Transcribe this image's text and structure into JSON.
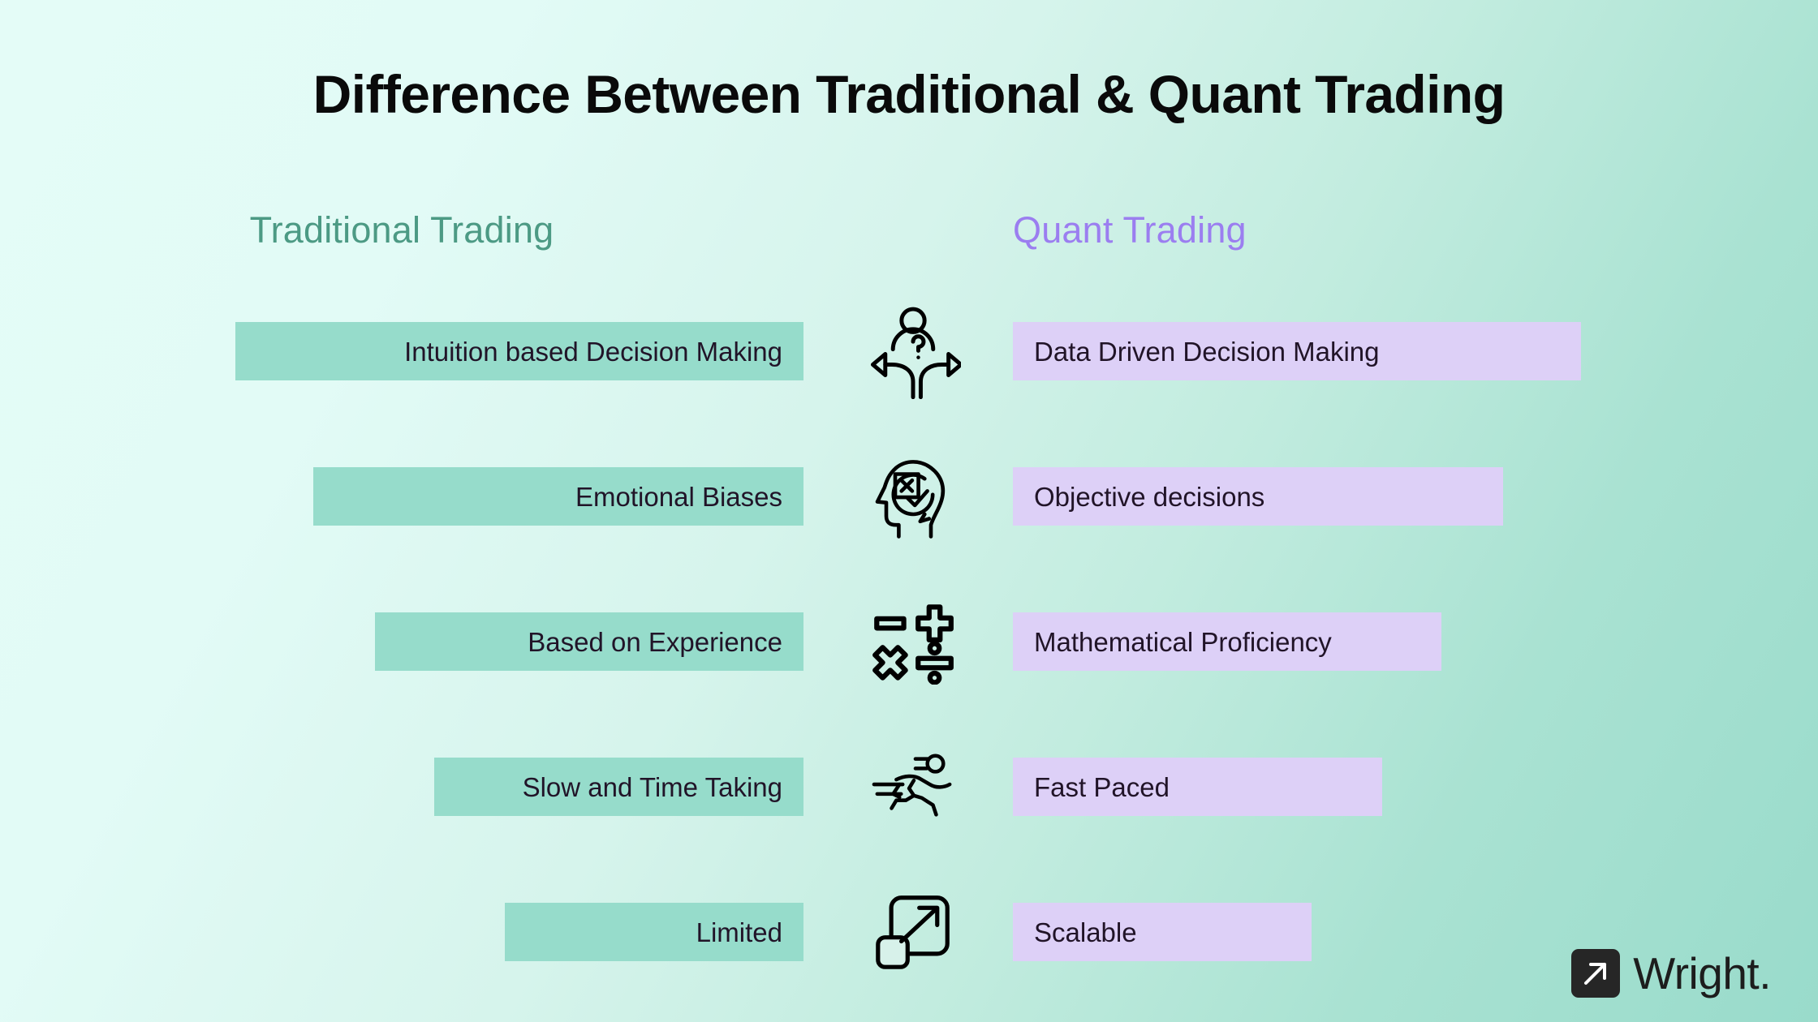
{
  "title": "Difference Between Traditional & Quant Trading",
  "colors": {
    "background_start": "#E4FCF7",
    "background_end": "#99DBCB",
    "left_bar": "#96DCCB",
    "right_bar": "#DDD0F7",
    "left_heading": "#4C9A84",
    "right_heading": "#9B7EF0",
    "bar_text": "#211428",
    "title_text": "#0A0A0A",
    "icon_stroke": "#000000",
    "logo_mark": "#262626"
  },
  "columns": {
    "left_heading": "Traditional Trading",
    "right_heading": "Quant Trading"
  },
  "rows": [
    {
      "left": "Intuition based Decision Making",
      "right": "Data Driven Decision Making",
      "icon": "decision-fork-icon",
      "left_bar_width": 700,
      "right_bar_width": 700
    },
    {
      "left": "Emotional Biases",
      "right": "Objective decisions",
      "icon": "head-bias-icon",
      "left_bar_width": 604,
      "right_bar_width": 604
    },
    {
      "left": "Based on Experience",
      "right": "Mathematical Proficiency",
      "icon": "math-operators-icon",
      "left_bar_width": 528,
      "right_bar_width": 528
    },
    {
      "left": "Slow and Time Taking",
      "right": "Fast Paced",
      "icon": "running-person-icon",
      "left_bar_width": 455,
      "right_bar_width": 455
    },
    {
      "left": "Limited",
      "right": "Scalable",
      "icon": "scale-expand-icon",
      "left_bar_width": 368,
      "right_bar_width": 368
    }
  ],
  "logo": {
    "text": "Wright.",
    "mark_icon": "arrow-up-right-icon"
  }
}
